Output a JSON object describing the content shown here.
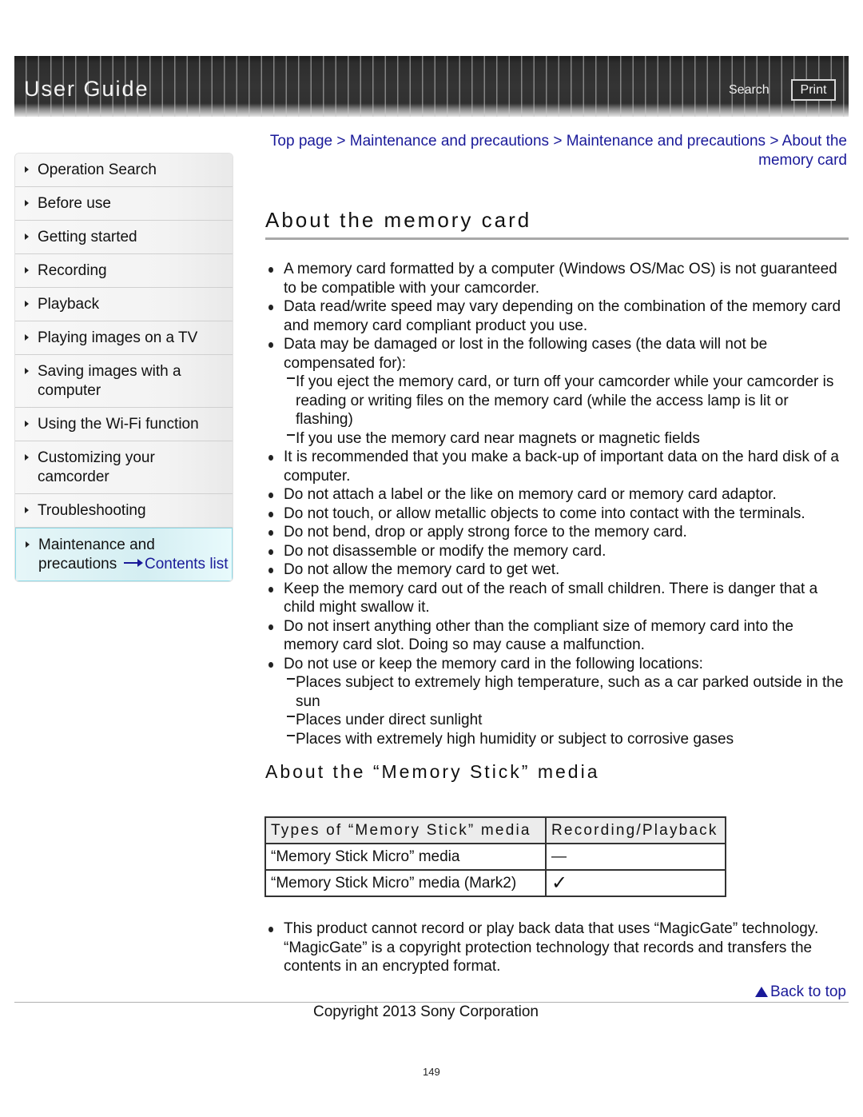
{
  "header": {
    "title": "User Guide",
    "search_label": "Search",
    "print_label": "Print"
  },
  "sidebar": {
    "items": [
      {
        "label": "Operation Search"
      },
      {
        "label": "Before use"
      },
      {
        "label": "Getting started"
      },
      {
        "label": "Recording"
      },
      {
        "label": "Playback"
      },
      {
        "label": "Playing images on a TV"
      },
      {
        "label": "Saving images with a computer"
      },
      {
        "label": "Using the Wi-Fi function"
      },
      {
        "label": "Customizing your camcorder"
      },
      {
        "label": "Troubleshooting"
      },
      {
        "label": "Maintenance and precautions",
        "active": true
      }
    ],
    "contents_link": "Contents list"
  },
  "breadcrumb": {
    "items": [
      "Top page",
      "Maintenance and precautions",
      "Maintenance and precautions",
      "About the memory card"
    ],
    "separator": ">"
  },
  "page_title": "About the memory card",
  "bullets": [
    {
      "text": "A memory card formatted by a computer (Windows OS/Mac OS) is not guaranteed to be compatible with your camcorder."
    },
    {
      "text": "Data read/write speed may vary depending on the combination of the memory card and memory card compliant product you use."
    },
    {
      "text": "Data may be damaged or lost in the following cases (the data will not be compensated for):",
      "sub": [
        "If you eject the memory card, or turn off your camcorder while your camcorder is reading or writing files on the memory card (while the access lamp is lit or flashing)",
        "If you use the memory card near magnets or magnetic fields"
      ]
    },
    {
      "text": "It is recommended that you make a back-up of important data on the hard disk of a computer."
    },
    {
      "text": "Do not attach a label or the like on memory card or memory card adaptor."
    },
    {
      "text": "Do not touch, or allow metallic objects to come into contact with the terminals."
    },
    {
      "text": "Do not bend, drop or apply strong force to the memory card."
    },
    {
      "text": "Do not disassemble or modify the memory card."
    },
    {
      "text": "Do not allow the memory card to get wet."
    },
    {
      "text": "Keep the memory card out of the reach of small children. There is danger that a child might swallow it."
    },
    {
      "text": "Do not insert anything other than the compliant size of memory card into the memory card slot. Doing so may cause a malfunction."
    },
    {
      "text": "Do not use or keep the memory card in the following locations:",
      "sub": [
        "Places subject to extremely high temperature, such as a car parked outside in the sun",
        "Places under direct sunlight",
        "Places with extremely high humidity or subject to corrosive gases"
      ]
    }
  ],
  "memory_stick": {
    "title": "About the “Memory Stick” media",
    "table": {
      "headers": [
        "Types of “Memory Stick” media",
        "Recording/Playback"
      ],
      "rows": [
        [
          "“Memory Stick Micro” media",
          "—"
        ],
        [
          "“Memory Stick Micro” media (Mark2)",
          "✓"
        ]
      ]
    },
    "note": "This product cannot record or play back data that uses “MagicGate” technology. “MagicGate” is a copyright protection technology that records and transfers the contents in an encrypted format."
  },
  "footer": {
    "back_to_top": "Back to top",
    "copyright": "Copyright 2013 Sony Corporation",
    "page_number": "149"
  }
}
